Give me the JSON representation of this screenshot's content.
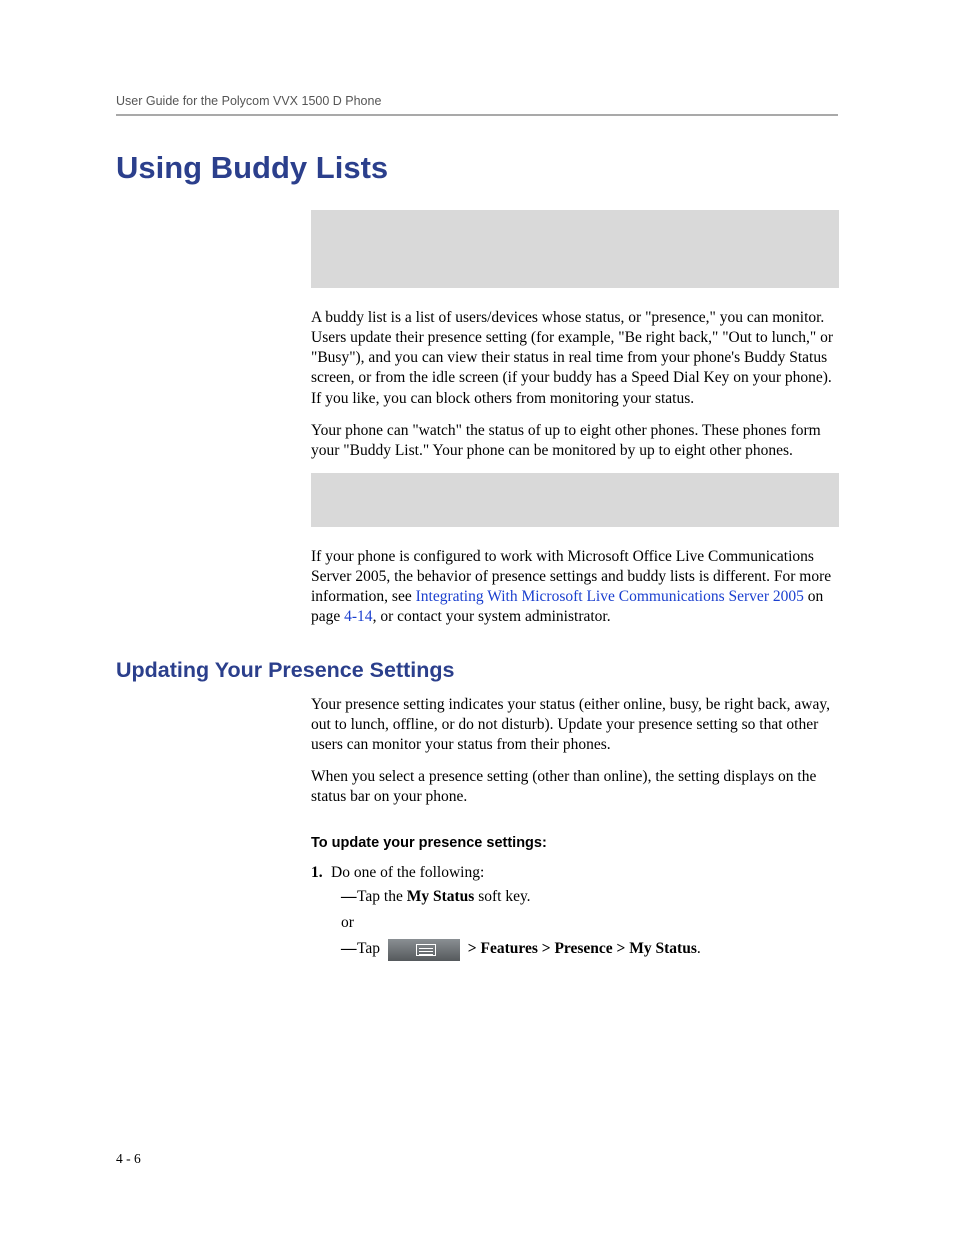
{
  "header": "User Guide for the Polycom VVX 1500 D Phone",
  "h1": "Using Buddy Lists",
  "para1": "A buddy list is a list of users/devices whose status, or \"presence,\" you can monitor. Users update their presence setting (for example, \"Be right back,\" \"Out to lunch,\" or \"Busy\"), and you can view their status in real time from your phone's Buddy Status screen, or from the idle screen (if your buddy has a Speed Dial Key on your phone). If you like, you can block others from monitoring your status.",
  "para2": "Your phone can \"watch\" the status of up to eight other phones. These phones form your \"Buddy List.\" Your phone can be monitored by up to eight other phones.",
  "para3_a": "If your phone is configured to work with Microsoft Office Live Communications Server 2005, the behavior of presence settings and buddy lists is different. For more information, see ",
  "para3_link": "Integrating With Microsoft Live Communications Server 2005",
  "para3_b": " on page ",
  "para3_pageref": "4-14",
  "para3_c": ", or contact your system administrator.",
  "h2": "Updating Your Presence Settings",
  "para4": "Your presence setting indicates your status (either online, busy, be right back, away, out to lunch, offline, or do not disturb). Update your presence setting so that other users can monitor your status from their phones.",
  "para5": "When you select a presence setting (other than online), the setting displays on the status bar on your phone.",
  "proc_head": "To update your presence settings:",
  "step1_num": "1.",
  "step1_text": "Do one of the following:",
  "step1a_pre": "Tap the ",
  "step1a_bold": "My Status",
  "step1a_post": " soft key.",
  "or": "or",
  "step1b_pre": "Tap ",
  "step1b_post_bold": " > Features > Presence > My Status",
  "step1b_period": ".",
  "footer": "4 - 6"
}
